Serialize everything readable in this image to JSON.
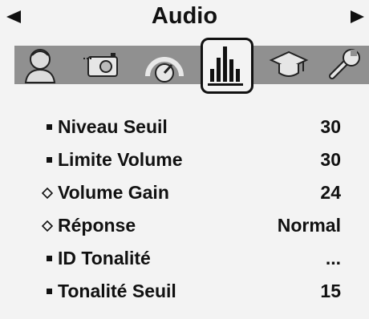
{
  "header": {
    "title": "Audio",
    "prev_icon": "arrow-left-icon",
    "next_icon": "arrow-right-icon"
  },
  "tabs": [
    {
      "icon": "user-icon",
      "selected": false
    },
    {
      "icon": "camera-icon",
      "selected": false
    },
    {
      "icon": "gauge-icon",
      "selected": false
    },
    {
      "icon": "equalizer-icon",
      "selected": true
    },
    {
      "icon": "graduation-cap-icon",
      "selected": false
    },
    {
      "icon": "wrench-icon",
      "selected": false
    }
  ],
  "menu": {
    "items": [
      {
        "marker": "square",
        "label": "Niveau Seuil",
        "value": "30"
      },
      {
        "marker": "square",
        "label": "Limite Volume",
        "value": "30"
      },
      {
        "marker": "diamond",
        "label": "Volume Gain",
        "value": "24"
      },
      {
        "marker": "diamond",
        "label": "Réponse",
        "value": "Normal"
      },
      {
        "marker": "square",
        "label": "ID Tonalité",
        "value": "..."
      },
      {
        "marker": "square",
        "label": "Tonalité Seuil",
        "value": "15"
      }
    ]
  },
  "colors": {
    "background": "#f3f3f3",
    "icon_band": "#909090",
    "text": "#111111"
  }
}
